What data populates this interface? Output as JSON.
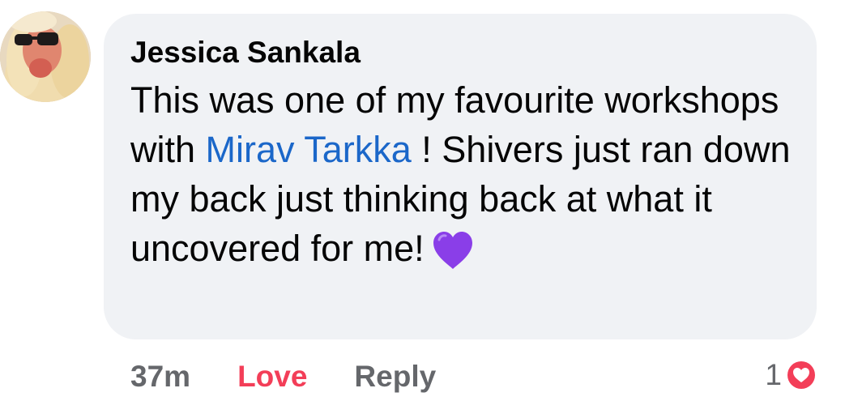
{
  "comment": {
    "author": "Jessica Sankala",
    "text_before_mention": "This was one of my favourite workshops with ",
    "mention": "Mirav Tarkka",
    "text_after_mention": " ! Shivers just ran down my back just thinking back at what it uncovered for me!",
    "emoji": "purple-heart"
  },
  "actions": {
    "timestamp": "37m",
    "love_label": "Love",
    "reply_label": "Reply"
  },
  "reactions": {
    "count": "1",
    "type": "love",
    "color": "#f33e58"
  },
  "colors": {
    "bubble": "#f0f2f5",
    "mention": "#1b67c9",
    "secondary_text": "#65676b",
    "love": "#f33e58",
    "emoji_purple": "#8a3ee8"
  }
}
